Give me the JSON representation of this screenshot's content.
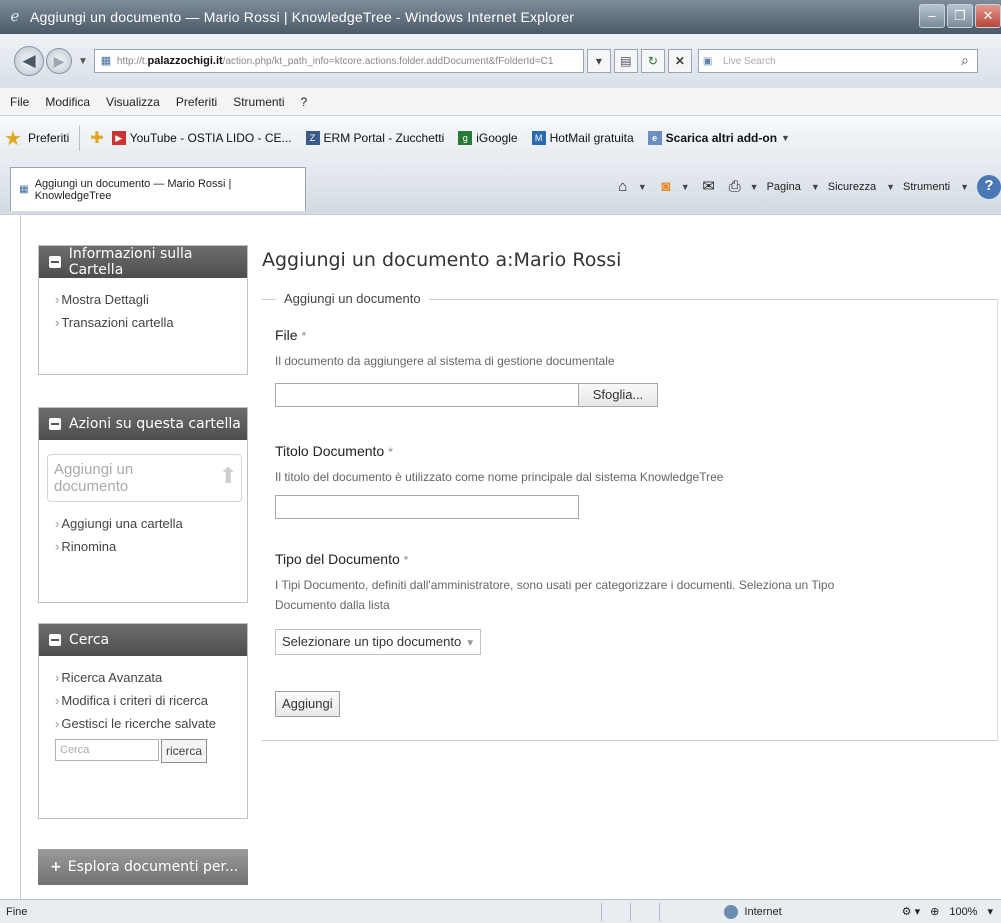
{
  "window": {
    "title": "Aggiungi un documento — Mario Rossi | KnowledgeTree - Windows Internet Explorer"
  },
  "address": {
    "url_prefix": "http://t.",
    "url_domain": "palazzochigi.it",
    "url_rest": "/action.php/kt_path_info=ktcore.actions.folder.addDocument&fFolderId=C1",
    "search_placeholder": "Live Search"
  },
  "menu": [
    "File",
    "Modifica",
    "Visualizza",
    "Preferiti",
    "Strumenti",
    "?"
  ],
  "favorites": {
    "label": "Preferiti",
    "items": [
      {
        "label": "YouTube - OSTIA LIDO - CE...",
        "icon": "youtube-icon"
      },
      {
        "label": "ERM Portal - Zucchetti",
        "icon": "zucchetti-icon"
      },
      {
        "label": "iGoogle",
        "icon": "igoogle-icon"
      },
      {
        "label": "HotMail gratuita",
        "icon": "hotmail-icon"
      },
      {
        "label": "Scarica altri add-on",
        "icon": "ie-page-icon"
      }
    ]
  },
  "tab": {
    "label": "Aggiungi un documento — Mario Rossi | KnowledgeTree"
  },
  "commands": {
    "pagina": "Pagina",
    "sicurezza": "Sicurezza",
    "strumenti": "Strumenti"
  },
  "sidebar": {
    "info": {
      "title": "Informazioni sulla Cartella",
      "links": [
        "Mostra Dettagli",
        "Transazioni cartella"
      ]
    },
    "actions": {
      "title": "Azioni su questa cartella",
      "primary": "Aggiungi un documento",
      "links": [
        "Aggiungi una cartella",
        "Rinomina"
      ]
    },
    "search": {
      "title": "Cerca",
      "links": [
        "Ricerca Avanzata",
        "Modifica i criteri di ricerca",
        "Gestisci le ricerche salvate"
      ],
      "placeholder": "Cerca",
      "button": "ricerca"
    },
    "explore": {
      "title": "Esplora documenti per..."
    }
  },
  "main": {
    "heading": "Aggiungi un documento a:Mario Rossi",
    "legend": "Aggiungi un documento",
    "file_label": "File",
    "file_desc": "Il documento da aggiungere al sistema di gestione documentale",
    "browse": "Sfoglia...",
    "title_label": "Titolo Documento",
    "title_desc": "Il titolo del documento è utilizzato come nome principale dal sistema KnowledgeTree",
    "type_label": "Tipo del Documento",
    "type_desc_1": "I Tipi Documento, definiti dall'amministratore, sono usati per categorizzare i documenti. Seleziona un Tipo",
    "type_desc_2": "Documento dalla lista",
    "type_select": "Selezionare un tipo documento",
    "submit": "Aggiungi",
    "required_mark": "*"
  },
  "status": {
    "left": "Fine",
    "zone": "Internet",
    "zoom": "100%"
  }
}
